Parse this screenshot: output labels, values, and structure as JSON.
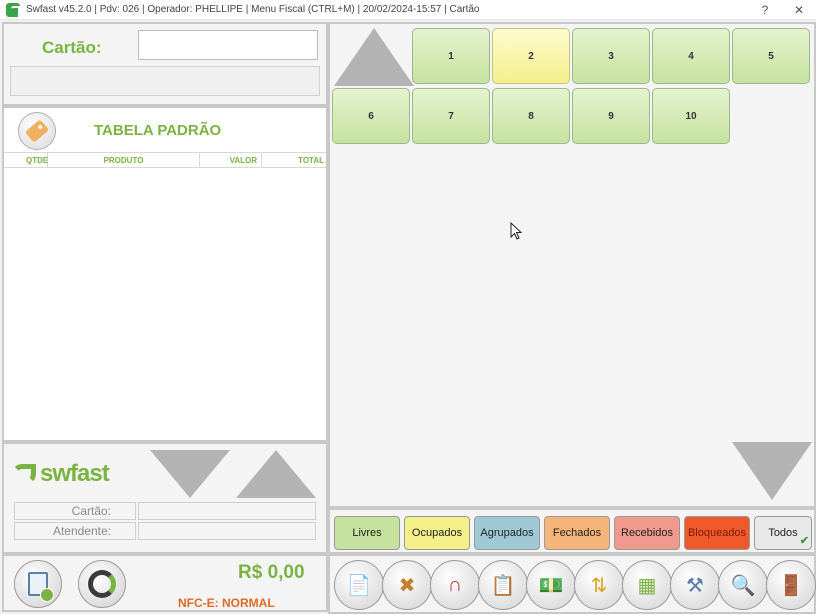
{
  "window": {
    "title": "Swfast v45.2.0 | Pdv: 026 | Operador: PHELLIPE | Menu Fiscal (CTRL+M) | 20/02/2024-15:57 | Cartão",
    "help_label": "?",
    "close_label": "✕"
  },
  "card": {
    "label": "Cartão:",
    "input_value": ""
  },
  "table": {
    "title": "TABELA PADRÃO",
    "columns": [
      "QTDE",
      "PRODUTO",
      "VALOR",
      "TOTAL"
    ],
    "rows": []
  },
  "brand": {
    "name": "swfast"
  },
  "info": {
    "card_label": "Cartão:",
    "card_value": "",
    "attendant_label": "Atendente:",
    "attendant_value": ""
  },
  "totals": {
    "amount": "R$ 0,00",
    "nfce_status": "NFC-E: NORMAL"
  },
  "mesas": [
    {
      "label": "1",
      "status": "livre"
    },
    {
      "label": "2",
      "status": "ocupado"
    },
    {
      "label": "3",
      "status": "livre"
    },
    {
      "label": "4",
      "status": "livre"
    },
    {
      "label": "5",
      "status": "livre"
    },
    {
      "label": "6",
      "status": "livre"
    },
    {
      "label": "7",
      "status": "livre"
    },
    {
      "label": "8",
      "status": "livre"
    },
    {
      "label": "9",
      "status": "livre"
    },
    {
      "label": "10",
      "status": "livre"
    }
  ],
  "status_filters": [
    {
      "label": "Livres",
      "color": "#c6e29f",
      "text_color": "#222222"
    },
    {
      "label": "Ocupados",
      "color": "#f3f08a",
      "text_color": "#222222"
    },
    {
      "label": "Agrupados",
      "color": "#9fc9d4",
      "text_color": "#222222"
    },
    {
      "label": "Fechados",
      "color": "#f5b57a",
      "text_color": "#222222"
    },
    {
      "label": "Recebidos",
      "color": "#f09a8e",
      "text_color": "#222222"
    },
    {
      "label": "Bloqueados",
      "color": "#f05a2a",
      "text_color": "#7a1a00"
    },
    {
      "label": "Todos",
      "color": "#e8e8e8",
      "text_color": "#222222",
      "selected": true
    }
  ],
  "toolbar_icons": [
    "cancel-document-icon",
    "tools-icon",
    "magnet-icon",
    "clipboard-icon",
    "money-icon",
    "transfer-icon",
    "tables-grid-icon",
    "toolbox-icon",
    "search-icon",
    "exit-door-icon"
  ],
  "colors": {
    "accent_green": "#7bb342",
    "nfce_orange": "#e06a2a"
  }
}
